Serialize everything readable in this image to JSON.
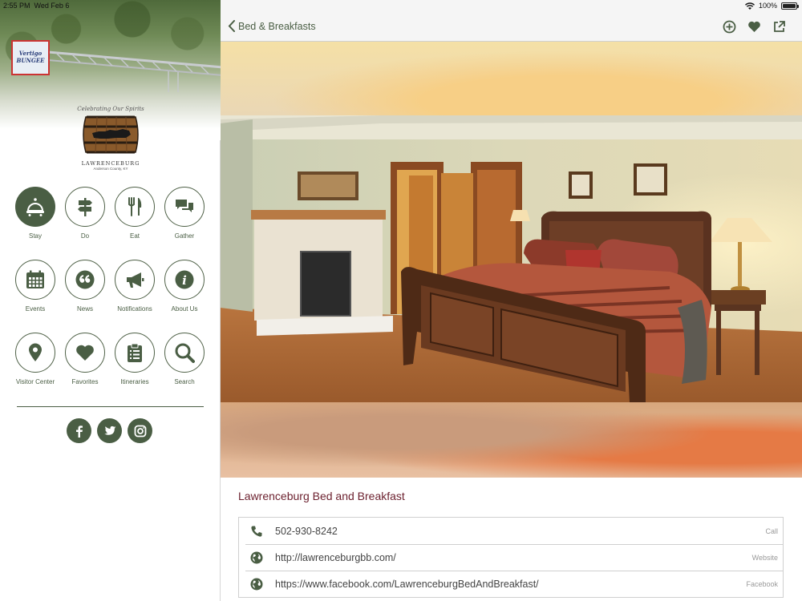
{
  "status_bar": {
    "time": "2:55 PM",
    "date": "Wed Feb 6",
    "battery": "100%"
  },
  "sidebar": {
    "hero_sign": "Vertigo BUNGEE",
    "logo": {
      "tagline": "Celebrating Our Spirits",
      "town": "LAWRENCEBURG",
      "county": "Anderson County, KY"
    },
    "nav_items": [
      {
        "label": "Stay",
        "icon": "bell-icon",
        "active": true
      },
      {
        "label": "Do",
        "icon": "signpost-icon"
      },
      {
        "label": "Eat",
        "icon": "fork-knife-icon"
      },
      {
        "label": "Gather",
        "icon": "chat-bubbles-icon"
      },
      {
        "label": "Events",
        "icon": "calendar-icon"
      },
      {
        "label": "News",
        "icon": "quote-icon"
      },
      {
        "label": "Notifications",
        "icon": "megaphone-icon"
      },
      {
        "label": "About Us",
        "icon": "info-icon"
      },
      {
        "label": "Visitor Center",
        "icon": "map-pin-icon"
      },
      {
        "label": "Favorites",
        "icon": "heart-icon"
      },
      {
        "label": "Itineraries",
        "icon": "clipboard-icon"
      },
      {
        "label": "Search",
        "icon": "search-icon"
      }
    ],
    "social": [
      "facebook-icon",
      "twitter-icon",
      "instagram-icon"
    ]
  },
  "header": {
    "back_label": "Bed & Breakfasts",
    "actions": [
      "add-icon",
      "heart-icon",
      "share-icon"
    ]
  },
  "place": {
    "title": "Lawrenceburg Bed and Breakfast",
    "contacts": [
      {
        "icon": "phone-icon",
        "value": "502-930-8242",
        "kind": "Call"
      },
      {
        "icon": "globe-icon",
        "value": "http://lawrenceburgbb.com/",
        "kind": "Website"
      },
      {
        "icon": "globe-icon",
        "value": "https://www.facebook.com/LawrenceburgBedAndBreakfast/",
        "kind": "Facebook"
      }
    ]
  },
  "colors": {
    "accent": "#4a5e44",
    "title": "#6b1f2d",
    "nav_bg": "#f5f5f5"
  }
}
